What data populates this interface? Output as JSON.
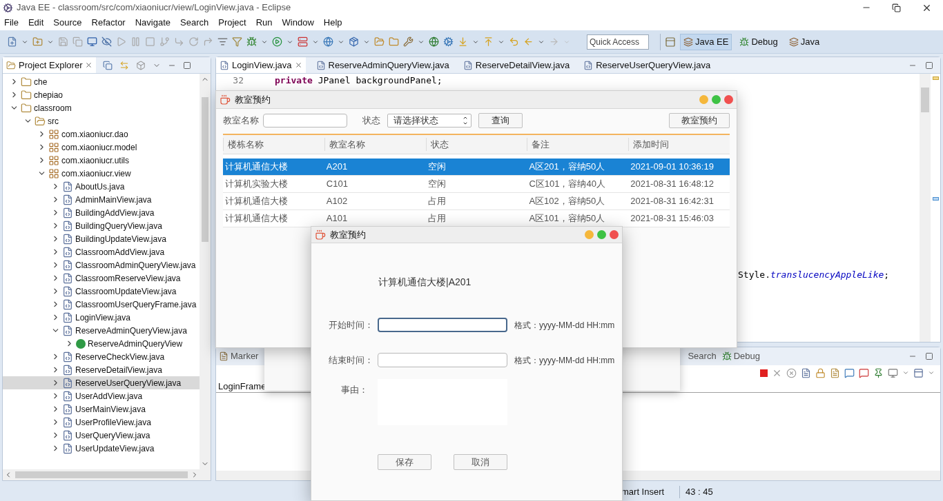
{
  "window": {
    "title": "Java EE - classroom/src/com/xiaoniucr/view/LoginView.java - Eclipse"
  },
  "menu": [
    "File",
    "Edit",
    "Source",
    "Refactor",
    "Navigate",
    "Search",
    "Project",
    "Run",
    "Window",
    "Help"
  ],
  "quick_access": {
    "placeholder": "Quick Access"
  },
  "perspectives": [
    {
      "label": "Java EE",
      "selected": true
    },
    {
      "label": "Debug",
      "selected": false
    },
    {
      "label": "Java",
      "selected": false
    }
  ],
  "explorer": {
    "title": "Project Explorer",
    "tree": [
      {
        "label": "che",
        "kind": "project",
        "expanded": false,
        "selected": false
      },
      {
        "label": "chepiao",
        "kind": "project",
        "expanded": false,
        "selected": false
      },
      {
        "label": "classroom",
        "kind": "project",
        "expanded": true,
        "selected": false,
        "children": [
          {
            "label": "src",
            "kind": "folder",
            "expanded": true,
            "selected": false,
            "children": [
              {
                "label": "com.xiaoniucr.dao",
                "kind": "package",
                "expanded": false,
                "selected": false
              },
              {
                "label": "com.xiaoniucr.model",
                "kind": "package",
                "expanded": false,
                "selected": false
              },
              {
                "label": "com.xiaoniucr.utils",
                "kind": "package",
                "expanded": false,
                "selected": false
              },
              {
                "label": "com.xiaoniucr.view",
                "kind": "package",
                "expanded": true,
                "selected": false,
                "children": [
                  {
                    "label": "AboutUs.java",
                    "kind": "file",
                    "expanded": false,
                    "selected": false
                  },
                  {
                    "label": "AdminMainView.java",
                    "kind": "file",
                    "expanded": false,
                    "selected": false
                  },
                  {
                    "label": "BuildingAddView.java",
                    "kind": "file",
                    "expanded": false,
                    "selected": false
                  },
                  {
                    "label": "BuildingQueryView.java",
                    "kind": "file",
                    "expanded": false,
                    "selected": false
                  },
                  {
                    "label": "BuildingUpdateView.java",
                    "kind": "file",
                    "expanded": false,
                    "selected": false
                  },
                  {
                    "label": "ClassroomAddView.java",
                    "kind": "file",
                    "expanded": false,
                    "selected": false
                  },
                  {
                    "label": "ClassroomAdminQueryView.java",
                    "kind": "file",
                    "expanded": false,
                    "selected": false
                  },
                  {
                    "label": "ClassroomReserveView.java",
                    "kind": "file",
                    "expanded": false,
                    "selected": false
                  },
                  {
                    "label": "ClassroomUpdateView.java",
                    "kind": "file",
                    "expanded": false,
                    "selected": false
                  },
                  {
                    "label": "ClassroomUserQueryFrame.java",
                    "kind": "file",
                    "expanded": false,
                    "selected": false
                  },
                  {
                    "label": "LoginView.java",
                    "kind": "file",
                    "expanded": false,
                    "selected": false
                  },
                  {
                    "label": "ReserveAdminQueryView.java",
                    "kind": "file",
                    "expanded": true,
                    "selected": false,
                    "children": [
                      {
                        "label": "ReserveAdminQueryView",
                        "kind": "class",
                        "expanded": false,
                        "selected": false
                      }
                    ]
                  },
                  {
                    "label": "ReserveCheckView.java",
                    "kind": "file",
                    "expanded": false,
                    "selected": false
                  },
                  {
                    "label": "ReserveDetailView.java",
                    "kind": "file",
                    "expanded": false,
                    "selected": false
                  },
                  {
                    "label": "ReserveUserQueryView.java",
                    "kind": "file",
                    "expanded": false,
                    "selected": true
                  },
                  {
                    "label": "UserAddView.java",
                    "kind": "file",
                    "expanded": false,
                    "selected": false
                  },
                  {
                    "label": "UserMainView.java",
                    "kind": "file",
                    "expanded": false,
                    "selected": false
                  },
                  {
                    "label": "UserProfileView.java",
                    "kind": "file",
                    "expanded": false,
                    "selected": false
                  },
                  {
                    "label": "UserQueryView.java",
                    "kind": "file",
                    "expanded": false,
                    "selected": false
                  },
                  {
                    "label": "UserUpdateView.java",
                    "kind": "file",
                    "expanded": false,
                    "selected": false
                  }
                ]
              }
            ]
          }
        ]
      }
    ]
  },
  "editor": {
    "tabs": [
      {
        "label": "LoginView.java",
        "selected": true
      },
      {
        "label": "ReserveAdminQueryView.java",
        "selected": false
      },
      {
        "label": "ReserveDetailView.java",
        "selected": false
      },
      {
        "label": "ReserveUserQueryView.java",
        "selected": false
      }
    ],
    "lines": [
      {
        "number": "32",
        "keyword": "private",
        "code": "JPanel backgroundPanel;"
      }
    ],
    "fragment": {
      "code": "Style.",
      "field": "translucencyAppleLike",
      "end": ";"
    }
  },
  "bottom_panel": {
    "tabs": [
      "Marker",
      "Search",
      "Debug"
    ],
    "console": "LoginFrame"
  },
  "status_bar": [
    "mart Insert",
    "43 : 45"
  ],
  "query_window": {
    "title": "教室预约",
    "name_label": "教室名称",
    "status_label": "状态",
    "status_select": "请选择状态",
    "query_button": "查询",
    "reserve_button": "教室预约",
    "columns": [
      "楼栋名称",
      "教室名称",
      "状态",
      "备注",
      "添加时间"
    ],
    "rows": [
      {
        "cells": [
          "计算机通信大楼",
          "A201",
          "空闲",
          "A区201，容纳50人",
          "2021-09-01 10:36:19"
        ],
        "selected": true
      },
      {
        "cells": [
          "计算机实验大楼",
          "C101",
          "空闲",
          "C区101，容纳40人",
          "2021-08-31 16:48:12"
        ],
        "selected": false
      },
      {
        "cells": [
          "计算机通信大楼",
          "A102",
          "占用",
          "A区102，容纳50人",
          "2021-08-31 16:42:31"
        ],
        "selected": false
      },
      {
        "cells": [
          "计算机通信大楼",
          "A101",
          "占用",
          "A区101，容纳50人",
          "2021-08-31 15:46:03"
        ],
        "selected": false
      }
    ]
  },
  "reserve_dialog": {
    "title": "教室预约",
    "heading": "计算机通信大楼|A201",
    "fields": [
      {
        "label": "开始时间：",
        "hint": "格式：yyyy-MM-dd HH:mm",
        "focused": true
      },
      {
        "label": "结束时间：",
        "hint": "格式：yyyy-MM-dd HH:mm",
        "focused": false
      }
    ],
    "reason_label": "事由：",
    "buttons": [
      "保存",
      "取消"
    ]
  }
}
